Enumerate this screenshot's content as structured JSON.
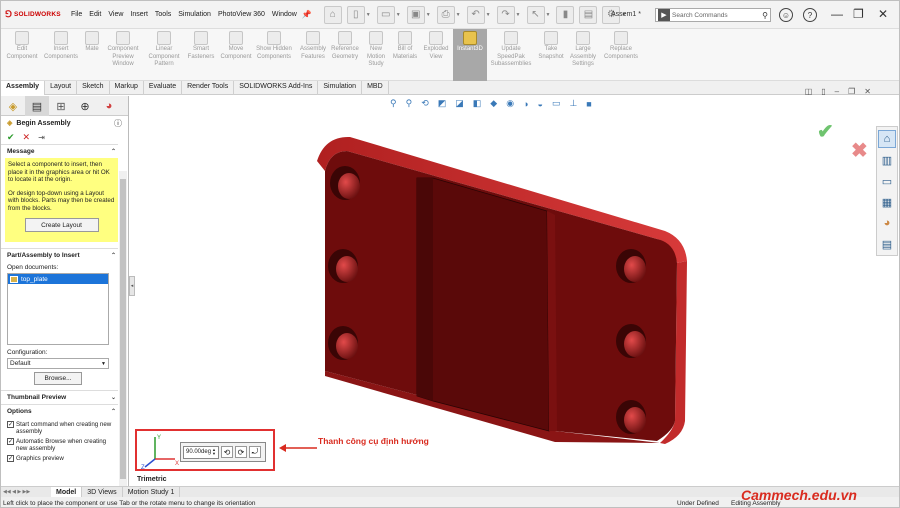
{
  "app": {
    "logo_text": "SOLIDWORKS",
    "document_title": "Assem1 *"
  },
  "menu": [
    "File",
    "Edit",
    "View",
    "Insert",
    "Tools",
    "Simulation",
    "PhotoView 360",
    "Window"
  ],
  "search": {
    "placeholder": "Search Commands"
  },
  "commands": [
    {
      "label": "Edit Component"
    },
    {
      "label": "Insert Components"
    },
    {
      "label": "Mate"
    },
    {
      "label": "Component Preview Window"
    },
    {
      "label": "Linear Component Pattern"
    },
    {
      "label": "Smart Fasteners"
    },
    {
      "label": "Move Component"
    },
    {
      "label": "Show Hidden Components"
    },
    {
      "label": "Assembly Features"
    },
    {
      "label": "Reference Geometry"
    },
    {
      "label": "New Motion Study"
    },
    {
      "label": "Bill of Materials"
    },
    {
      "label": "Exploded View"
    },
    {
      "label": "Instant3D",
      "active": true
    },
    {
      "label": "Update SpeedPak Subassemblies"
    },
    {
      "label": "Take Snapshot"
    },
    {
      "label": "Large Assembly Settings"
    },
    {
      "label": "Replace Components"
    }
  ],
  "tabs": [
    "Assembly",
    "Layout",
    "Sketch",
    "Markup",
    "Evaluate",
    "Render Tools",
    "SOLIDWORKS Add-Ins",
    "Simulation",
    "MBD"
  ],
  "property_manager": {
    "title": "Begin Assembly",
    "message_header": "Message",
    "message_p1": "Select a component to insert, then place it in the graphics area or hit OK to locate it at the origin.",
    "message_p2": "Or design top-down using a Layout with blocks. Parts may then be created from the blocks.",
    "create_layout": "Create Layout",
    "part_header": "Part/Assembly to Insert",
    "open_documents_label": "Open documents:",
    "open_documents": [
      "top_plate"
    ],
    "configuration_label": "Configuration:",
    "configuration_value": "Default",
    "browse": "Browse...",
    "thumbnail_header": "Thumbnail Preview",
    "options_header": "Options",
    "options": [
      {
        "label": "Start command when creating new assembly",
        "checked": true
      },
      {
        "label": "Automatic Browse when creating new assembly",
        "checked": true
      },
      {
        "label": "Graphics preview",
        "checked": true
      }
    ]
  },
  "graphics": {
    "orientation_label": "Trimetric",
    "angle_value": "90.00deg",
    "annotation": "Thanh công cụ định hướng",
    "triad": {
      "x": "X",
      "y": "Y",
      "z": "Z"
    }
  },
  "bottom_tabs": [
    "Model",
    "3D Views",
    "Motion Study 1"
  ],
  "status": {
    "message": "Left click to place the component or use Tab or the rotate menu to change its orientation",
    "definition": "Under Defined",
    "mode": "Editing Assembly"
  },
  "watermark": "Cammech.edu.vn",
  "colors": {
    "part": "#7a0f0f",
    "accent": "#d92b1f",
    "message_bg": "#ffff80"
  }
}
